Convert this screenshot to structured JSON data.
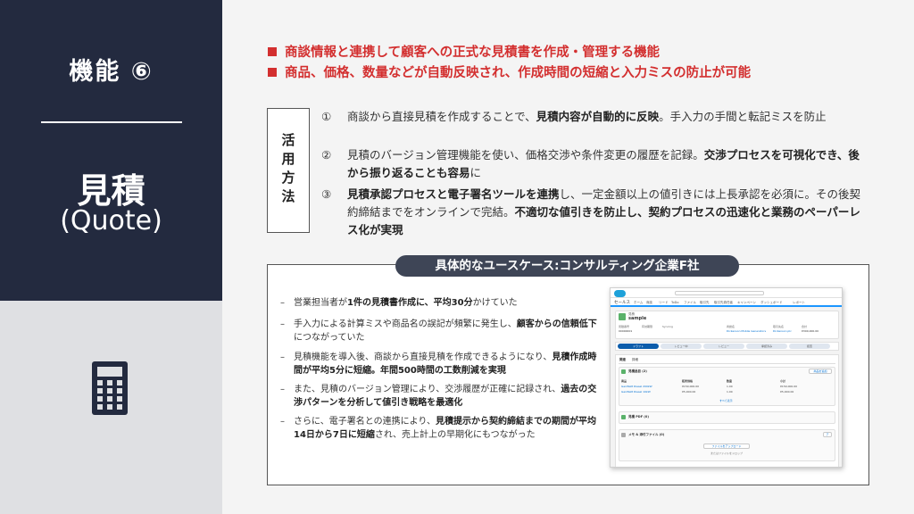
{
  "sidebar": {
    "feature_label": "機能 ⑥",
    "title_jp": "見積",
    "title_en": "(Quote)",
    "icon": "calculator-icon"
  },
  "headlines": [
    "商談情報と連携して顧客への正式な見積書を作成・管理する機能",
    "商品、価格、数量などが自動反映され、作成時間の短縮と入力ミスの防止が可能"
  ],
  "usage": {
    "label": "活用方法",
    "items": [
      {
        "num": "①",
        "parts": [
          {
            "t": "商談から直接見積を作成することで、",
            "b": false
          },
          {
            "t": "見積内容が自動的に反映",
            "b": true
          },
          {
            "t": "。手入力の手間と転記ミスを防止",
            "b": false
          }
        ]
      },
      {
        "num": "②",
        "parts": [
          {
            "t": "見積のバージョン管理機能を使い、価格交渉や条件変更の履歴を記録。",
            "b": false
          },
          {
            "t": "交渉プロセスを可視化でき、後から振り返ることも容易",
            "b": true
          },
          {
            "t": "に",
            "b": false
          }
        ]
      },
      {
        "num": "③",
        "parts": [
          {
            "t": "見積承認プロセスと電子署名ツールを連携",
            "b": true
          },
          {
            "t": "し、一定金額以上の値引きには上長承認を必須に。その後契約締結までをオンラインで完結。",
            "b": false
          },
          {
            "t": "不適切な値引きを防止し、契約プロセスの迅速化と業務のペーパーレス化が実現",
            "b": true
          }
        ]
      }
    ]
  },
  "case": {
    "title": "具体的なユースケース:コンサルティング企業F社",
    "items": [
      [
        {
          "t": "営業担当者が",
          "b": false
        },
        {
          "t": "1件の見積書作成に、平均30分",
          "b": true
        },
        {
          "t": "かけていた",
          "b": false
        }
      ],
      [
        {
          "t": "手入力による計算ミスや商品名の誤記が頻繁に発生し、",
          "b": false
        },
        {
          "t": "顧客からの信頼低下",
          "b": true
        },
        {
          "t": "につながっていた",
          "b": false
        }
      ],
      [
        {
          "t": "見積機能を導入後、商談から直接見積を作成できるようになり、",
          "b": false
        },
        {
          "t": "見積作成時間が平均5分に短縮。年間500時間の工数削減を実現",
          "b": true
        }
      ],
      [
        {
          "t": "また、見積のバージョン管理により、交渉履歴が正確に記録され、",
          "b": false
        },
        {
          "t": "過去の交渉パターンを分析して値引き戦略を最適化",
          "b": true
        }
      ],
      [
        {
          "t": "さらに、電子署名との連携により、",
          "b": false
        },
        {
          "t": "見積提示から契約締結までの期間が平均14日から7日に短縮",
          "b": true
        },
        {
          "t": "され、売上計上の早期化にもつながった",
          "b": false
        }
      ]
    ]
  },
  "screenshot": {
    "app_name": "セールス",
    "nav": [
      "ホーム",
      "商談",
      "リード",
      "ToDo",
      "ファイル",
      "取引先",
      "取引先責任者",
      "キャンペーン",
      "ダッシュボード",
      "レポート"
    ],
    "record_type": "見積",
    "record_name": "sample",
    "fields": [
      {
        "label": "見積番号",
        "value": "00000001"
      },
      {
        "label": "有効期限",
        "value": ""
      },
      {
        "label": "Syncing",
        "value": ""
      },
      {
        "label": "商談名",
        "value": "Dickenson Mobile Generators"
      },
      {
        "label": "取引先名",
        "value": "Dickenson plc"
      },
      {
        "label": "合計",
        "value": "¥300,000.00"
      }
    ],
    "path_steps": [
      "ドラフト",
      "レビュー中",
      "レビュー",
      "承認済み",
      "拒否"
    ],
    "tabs": [
      "関連",
      "詳細"
    ],
    "card1_title": "見積品目 (2)",
    "card1_button": "商品を追加",
    "table_headers": [
      "商品",
      "販売価格",
      "数量",
      "小計"
    ],
    "table_rows": [
      [
        "GenWatt Diesel 200kW",
        "¥150,000.00",
        "1.00",
        "¥150,000.00"
      ],
      [
        "GenWatt Diesel 10kW",
        "¥5,000.00",
        "1.00",
        "¥5,000.00"
      ]
    ],
    "view_all": "すべて表示",
    "card2_title": "見積 PDF (0)",
    "card3_title": "メモ & 添付ファイル (0)",
    "card3_button": "ファイルをアップロード",
    "card3_hint": "またはファイルをドロップ",
    "card3_upload": "ア"
  }
}
